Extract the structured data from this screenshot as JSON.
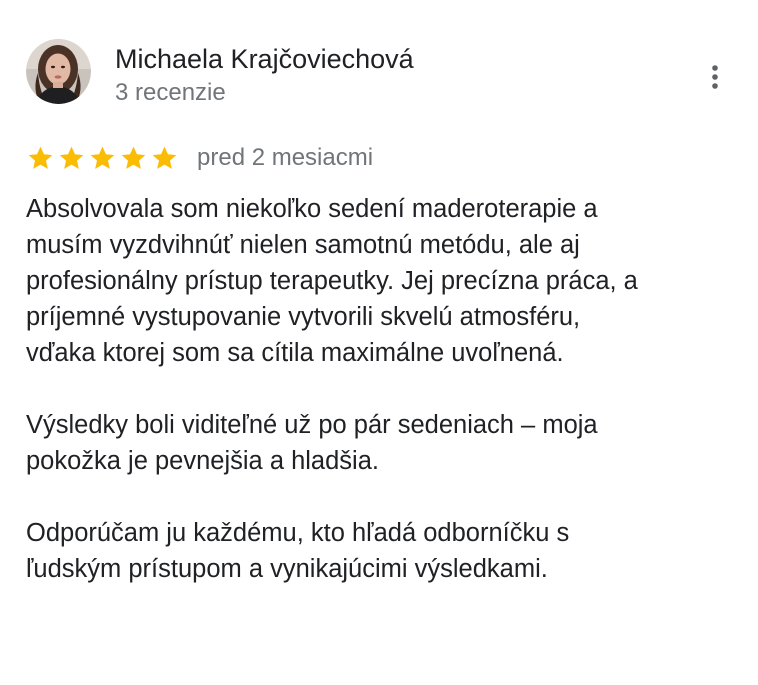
{
  "review": {
    "author_name": "Michaela Krajčoviechová",
    "review_count": "3 recenzie",
    "rating": 5,
    "rating_max": 5,
    "date": "pred 2 mesiacmi",
    "star_color": "#fbbc04",
    "icons": {
      "avatar": "avatar",
      "star": "star-icon",
      "more": "more-vert-icon"
    },
    "paragraphs": [
      [
        "Absolvovala som niekoľko sedení maderoterapie a",
        "musím vyzdvihnúť nielen samotnú metódu, ale aj",
        "profesionálny prístup terapeutky. Jej precízna práca, a",
        "príjemné vystupovanie vytvorili skvelú atmosféru,",
        "vďaka ktorej som sa cítila maximálne uvoľnená."
      ],
      [
        "Výsledky boli viditeľné už po pár sedeniach – moja",
        "pokožka je pevnejšia a hladšia."
      ],
      [
        "Odporúčam ju každému, kto hľadá odborníčku s",
        "ľudským prístupom a vynikajúcimi výsledkami."
      ]
    ]
  }
}
